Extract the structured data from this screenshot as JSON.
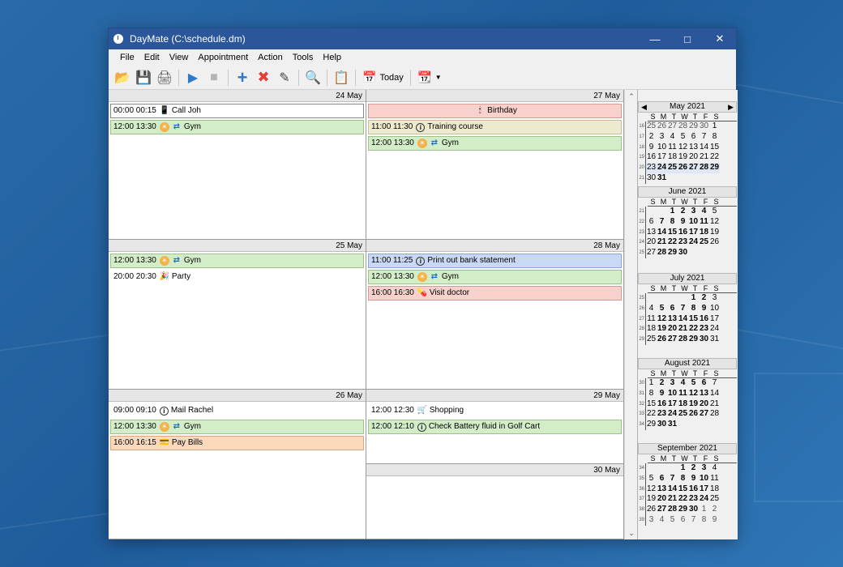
{
  "window": {
    "title": "DayMate (C:\\schedule.dm)"
  },
  "menu": [
    "File",
    "Edit",
    "View",
    "Appointment",
    "Action",
    "Tools",
    "Help"
  ],
  "toolbar": {
    "today_label": "Today"
  },
  "days": [
    {
      "date": "24 May",
      "appts": [
        {
          "time": "00:00 00:15",
          "text": "Call Joh",
          "color": "white",
          "icon": "phone-icon"
        },
        {
          "time": "12:00 13:30",
          "text": "Gym",
          "color": "green",
          "icon": "sun-icon",
          "repeat": true
        }
      ]
    },
    {
      "date": "25 May",
      "appts": [
        {
          "time": "12:00 13:30",
          "text": "Gym",
          "color": "green",
          "icon": "sun-icon",
          "repeat": true
        },
        {
          "time": "20:00 20:30",
          "text": "Party",
          "color": "plain",
          "icon": "party-icon"
        }
      ]
    },
    {
      "date": "26 May",
      "appts": [
        {
          "time": "09:00 09:10",
          "text": "Mail Rachel",
          "color": "plain",
          "icon": "info-icon"
        },
        {
          "time": "12:00 13:30",
          "text": "Gym",
          "color": "green",
          "icon": "sun-icon",
          "repeat": true
        },
        {
          "time": "16:00 16:15",
          "text": "Pay Bills",
          "color": "orange",
          "icon": "bill-icon"
        }
      ]
    },
    {
      "date": "27 May",
      "appts": [
        {
          "time": "",
          "text": "Birthday",
          "color": "pink",
          "icon": "candle-icon",
          "allday": true
        },
        {
          "time": "11:00 11:30",
          "text": "Training course",
          "color": "tan",
          "icon": "info-icon"
        },
        {
          "time": "12:00 13:30",
          "text": "Gym",
          "color": "green",
          "icon": "sun-icon",
          "repeat": true
        }
      ]
    },
    {
      "date": "28 May",
      "appts": [
        {
          "time": "11:00 11:25",
          "text": "Print out bank statement",
          "color": "blue",
          "icon": "info-icon"
        },
        {
          "time": "12:00 13:30",
          "text": "Gym",
          "color": "green",
          "icon": "sun-icon",
          "repeat": true
        },
        {
          "time": "16:00 16:30",
          "text": "Visit doctor",
          "color": "pink",
          "icon": "pill-icon"
        }
      ]
    },
    {
      "date": "29 May",
      "appts": [
        {
          "time": "12:00 12:30",
          "text": "Shopping",
          "color": "plain",
          "icon": "cart-icon"
        },
        {
          "time": "12:00 12:10",
          "text": "Check Battery fluid in Golf Cart",
          "color": "green",
          "icon": "info-icon"
        }
      ]
    },
    {
      "date": "30 May",
      "appts": []
    }
  ],
  "weekdays": [
    "S",
    "M",
    "T",
    "W",
    "T",
    "F",
    "S"
  ],
  "months": [
    {
      "title": "May 2021",
      "weeks": [
        {
          "wk": "16",
          "days": [
            [
              "25",
              "o"
            ],
            [
              "26",
              "o"
            ],
            [
              "27",
              "o"
            ],
            [
              "28",
              "o"
            ],
            [
              "29",
              "o"
            ],
            [
              "30",
              "o"
            ],
            [
              "1",
              ""
            ]
          ]
        },
        {
          "wk": "17",
          "days": [
            [
              "2",
              ""
            ],
            [
              "3",
              ""
            ],
            [
              "4",
              ""
            ],
            [
              "5",
              ""
            ],
            [
              "6",
              ""
            ],
            [
              "7",
              ""
            ],
            [
              "8",
              ""
            ]
          ]
        },
        {
          "wk": "18",
          "days": [
            [
              "9",
              ""
            ],
            [
              "10",
              ""
            ],
            [
              "11",
              ""
            ],
            [
              "12",
              ""
            ],
            [
              "13",
              ""
            ],
            [
              "14",
              ""
            ],
            [
              "15",
              ""
            ]
          ]
        },
        {
          "wk": "19",
          "days": [
            [
              "16",
              ""
            ],
            [
              "17",
              ""
            ],
            [
              "18",
              ""
            ],
            [
              "19",
              ""
            ],
            [
              "20",
              ""
            ],
            [
              "21",
              ""
            ],
            [
              "22",
              ""
            ]
          ]
        },
        {
          "wk": "20",
          "days": [
            [
              "23",
              "s"
            ],
            [
              "24",
              "b s"
            ],
            [
              "25",
              "b s"
            ],
            [
              "26",
              "b s"
            ],
            [
              "27",
              "b s"
            ],
            [
              "28",
              "b s"
            ],
            [
              "29",
              "b s"
            ]
          ]
        },
        {
          "wk": "21",
          "days": [
            [
              "30",
              ""
            ],
            [
              "31",
              "b"
            ],
            [
              "",
              ""
            ],
            [
              "",
              ""
            ],
            [
              "",
              ""
            ],
            [
              "",
              ""
            ],
            [
              "",
              ""
            ]
          ]
        }
      ]
    },
    {
      "title": "June 2021",
      "weeks": [
        {
          "wk": "21",
          "days": [
            [
              "",
              ""
            ],
            [
              "",
              ""
            ],
            [
              "1",
              "b"
            ],
            [
              "2",
              "b"
            ],
            [
              "3",
              "b"
            ],
            [
              "4",
              "b"
            ],
            [
              "5",
              ""
            ]
          ]
        },
        {
          "wk": "22",
          "days": [
            [
              "6",
              ""
            ],
            [
              "7",
              "b"
            ],
            [
              "8",
              "b"
            ],
            [
              "9",
              "b"
            ],
            [
              "10",
              "b"
            ],
            [
              "11",
              "b"
            ],
            [
              "12",
              ""
            ]
          ]
        },
        {
          "wk": "23",
          "days": [
            [
              "13",
              ""
            ],
            [
              "14",
              "b"
            ],
            [
              "15",
              "b"
            ],
            [
              "16",
              "b"
            ],
            [
              "17",
              "b"
            ],
            [
              "18",
              "b"
            ],
            [
              "19",
              ""
            ]
          ]
        },
        {
          "wk": "24",
          "days": [
            [
              "20",
              ""
            ],
            [
              "21",
              "b"
            ],
            [
              "22",
              "b"
            ],
            [
              "23",
              "b"
            ],
            [
              "24",
              "b"
            ],
            [
              "25",
              "b"
            ],
            [
              "26",
              ""
            ]
          ]
        },
        {
          "wk": "25",
          "days": [
            [
              "27",
              ""
            ],
            [
              "28",
              "b"
            ],
            [
              "29",
              "b"
            ],
            [
              "30",
              "b"
            ],
            [
              "",
              ""
            ],
            [
              "",
              ""
            ],
            [
              "",
              ""
            ]
          ]
        }
      ]
    },
    {
      "title": "July 2021",
      "weeks": [
        {
          "wk": "25",
          "days": [
            [
              "",
              ""
            ],
            [
              "",
              ""
            ],
            [
              "",
              ""
            ],
            [
              "",
              ""
            ],
            [
              "1",
              "b"
            ],
            [
              "2",
              "b"
            ],
            [
              "3",
              ""
            ]
          ]
        },
        {
          "wk": "26",
          "days": [
            [
              "4",
              ""
            ],
            [
              "5",
              "b"
            ],
            [
              "6",
              "b"
            ],
            [
              "7",
              "b"
            ],
            [
              "8",
              "b"
            ],
            [
              "9",
              "b"
            ],
            [
              "10",
              ""
            ]
          ]
        },
        {
          "wk": "27",
          "days": [
            [
              "11",
              ""
            ],
            [
              "12",
              "b"
            ],
            [
              "13",
              "b"
            ],
            [
              "14",
              "b"
            ],
            [
              "15",
              "b"
            ],
            [
              "16",
              "b"
            ],
            [
              "17",
              ""
            ]
          ]
        },
        {
          "wk": "28",
          "days": [
            [
              "18",
              ""
            ],
            [
              "19",
              "b"
            ],
            [
              "20",
              "b"
            ],
            [
              "21",
              "b"
            ],
            [
              "22",
              "b"
            ],
            [
              "23",
              "b"
            ],
            [
              "24",
              ""
            ]
          ]
        },
        {
          "wk": "29",
          "days": [
            [
              "25",
              ""
            ],
            [
              "26",
              "b"
            ],
            [
              "27",
              "b"
            ],
            [
              "28",
              "b"
            ],
            [
              "29",
              "b"
            ],
            [
              "30",
              "b"
            ],
            [
              "31",
              ""
            ]
          ]
        }
      ]
    },
    {
      "title": "August 2021",
      "weeks": [
        {
          "wk": "30",
          "days": [
            [
              "1",
              ""
            ],
            [
              "2",
              "b"
            ],
            [
              "3",
              "b"
            ],
            [
              "4",
              "b"
            ],
            [
              "5",
              "b"
            ],
            [
              "6",
              "b"
            ],
            [
              "7",
              ""
            ]
          ]
        },
        {
          "wk": "31",
          "days": [
            [
              "8",
              ""
            ],
            [
              "9",
              "b"
            ],
            [
              "10",
              "b"
            ],
            [
              "11",
              "b"
            ],
            [
              "12",
              "b"
            ],
            [
              "13",
              "b"
            ],
            [
              "14",
              ""
            ]
          ]
        },
        {
          "wk": "32",
          "days": [
            [
              "15",
              ""
            ],
            [
              "16",
              "b"
            ],
            [
              "17",
              "b"
            ],
            [
              "18",
              "b"
            ],
            [
              "19",
              "b"
            ],
            [
              "20",
              "b"
            ],
            [
              "21",
              ""
            ]
          ]
        },
        {
          "wk": "33",
          "days": [
            [
              "22",
              ""
            ],
            [
              "23",
              "b"
            ],
            [
              "24",
              "b"
            ],
            [
              "25",
              "b"
            ],
            [
              "26",
              "b"
            ],
            [
              "27",
              "b"
            ],
            [
              "28",
              ""
            ]
          ]
        },
        {
          "wk": "34",
          "days": [
            [
              "29",
              ""
            ],
            [
              "30",
              "b"
            ],
            [
              "31",
              "b"
            ],
            [
              "",
              ""
            ],
            [
              "",
              ""
            ],
            [
              "",
              ""
            ],
            [
              "",
              ""
            ]
          ]
        }
      ]
    },
    {
      "title": "September 2021",
      "weeks": [
        {
          "wk": "34",
          "days": [
            [
              "",
              ""
            ],
            [
              "",
              ""
            ],
            [
              "",
              ""
            ],
            [
              "1",
              "b"
            ],
            [
              "2",
              "b"
            ],
            [
              "3",
              "b"
            ],
            [
              "4",
              ""
            ]
          ]
        },
        {
          "wk": "35",
          "days": [
            [
              "5",
              ""
            ],
            [
              "6",
              "b"
            ],
            [
              "7",
              "b"
            ],
            [
              "8",
              "b"
            ],
            [
              "9",
              "b"
            ],
            [
              "10",
              "b"
            ],
            [
              "11",
              ""
            ]
          ]
        },
        {
          "wk": "36",
          "days": [
            [
              "12",
              ""
            ],
            [
              "13",
              "b"
            ],
            [
              "14",
              "b"
            ],
            [
              "15",
              "b"
            ],
            [
              "16",
              "b"
            ],
            [
              "17",
              "b"
            ],
            [
              "18",
              ""
            ]
          ]
        },
        {
          "wk": "37",
          "days": [
            [
              "19",
              ""
            ],
            [
              "20",
              "b"
            ],
            [
              "21",
              "b"
            ],
            [
              "22",
              "b"
            ],
            [
              "23",
              "b"
            ],
            [
              "24",
              "b"
            ],
            [
              "25",
              ""
            ]
          ]
        },
        {
          "wk": "38",
          "days": [
            [
              "26",
              ""
            ],
            [
              "27",
              "b"
            ],
            [
              "28",
              "b"
            ],
            [
              "29",
              "b"
            ],
            [
              "30",
              "b"
            ],
            [
              "1",
              "o"
            ],
            [
              "2",
              "o"
            ]
          ]
        },
        {
          "wk": "39",
          "days": [
            [
              "3",
              "o"
            ],
            [
              "4",
              "o"
            ],
            [
              "5",
              "o"
            ],
            [
              "6",
              "o"
            ],
            [
              "7",
              "o"
            ],
            [
              "8",
              "o"
            ],
            [
              "9",
              "o"
            ]
          ]
        }
      ]
    }
  ]
}
